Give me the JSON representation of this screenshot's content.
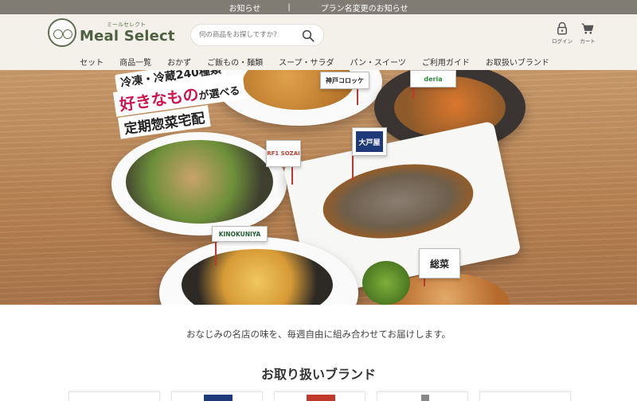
{
  "notice_bar": {
    "items": [
      "お知らせ",
      "プラン名変更のお知らせ"
    ],
    "separator": "|",
    "background": "#807c73"
  },
  "header": {
    "logo_kana": "ミールセレクト",
    "logo_text": "Meal Select",
    "search": {
      "placeholder": "何の商品をお探しですか？",
      "icon": "search-icon"
    },
    "login_label": "ログイン",
    "cart_label": "カート",
    "background": "#f4f1ea"
  },
  "nav": {
    "items": [
      "セット",
      "商品一覧",
      "おかず",
      "ご飯もの・麺類",
      "スープ・サラダ",
      "パン・スイーツ",
      "ご利用ガイド",
      "お取扱いブランド"
    ]
  },
  "hero": {
    "catch_1": "冷凍・冷蔵240種類",
    "catch_2_main": "好きなもの",
    "catch_2_rest": "が選べる",
    "catch_3": "定期惣菜宅配",
    "flags": {
      "kobe": "神戸コロッケ",
      "deria": "deria",
      "rf": "RF1 SOZAI",
      "ootoya": "大戸屋",
      "kinokuniya": "KINOKUNIYA",
      "souzai": "総菜"
    }
  },
  "tagline": "おなじみの名店の味を、毎週自由に組み合わせてお届けします。",
  "brand_section": {
    "title": "お取り扱いブランド",
    "card_count_visible": 5
  }
}
